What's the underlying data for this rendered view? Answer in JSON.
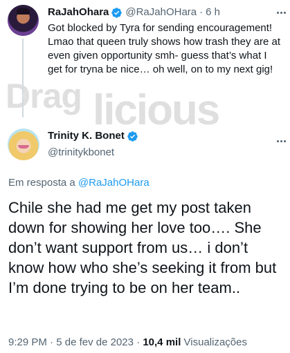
{
  "watermark": {
    "part1": "Drag",
    "part2": "licious"
  },
  "parent_tweet": {
    "name": "RaJahOhara",
    "handle": "@RaJahOHara",
    "separator": "·",
    "time": "6 h",
    "text": "Got blocked by Tyra for sending encouragement! Lmao that queen truly shows how trash they are at even given opportunity smh- guess that’s what I get for tryna be nice… oh well, on to my next gig!"
  },
  "main_tweet": {
    "name": "Trinity K. Bonet",
    "handle": "@trinitykbonet",
    "reply_prefix": "Em resposta a",
    "reply_handle": "@RaJahOHara",
    "text": "Chile she had me get my post taken down for showing her love too…. She don’t want support from us… i don’t know how who she’s seeking it from but I’m done trying to be on her team..",
    "time": "9:29 PM",
    "date": "5 de fev de 2023",
    "separator": "·",
    "views_count": "10,4 mil",
    "views_label": "Visualizações"
  },
  "icons": {
    "verified": "verified-badge-icon",
    "more": "more-options-icon"
  },
  "colors": {
    "accent": "#1d9bf0",
    "secondary_text": "#536471",
    "primary_text": "#0f1419",
    "watermark": "#d9d9d9"
  }
}
